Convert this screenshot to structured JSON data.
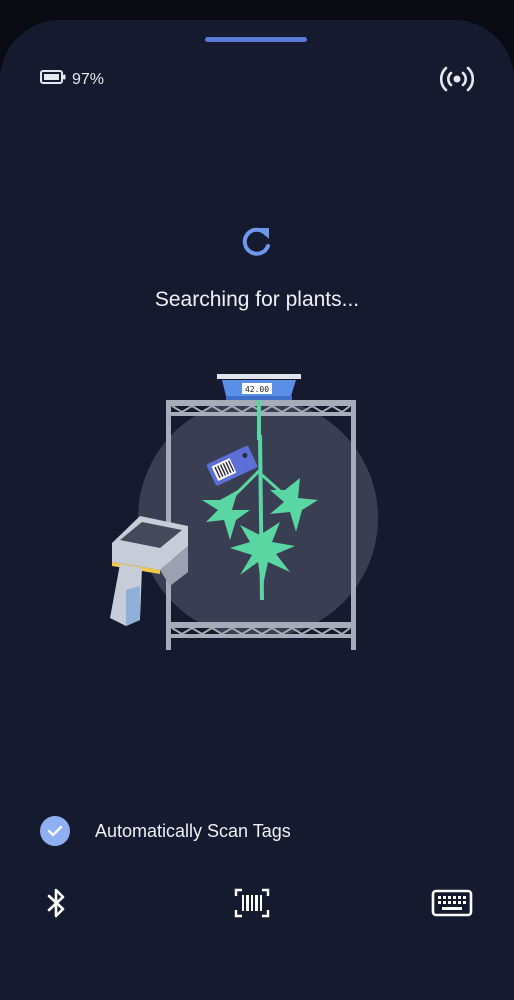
{
  "status": {
    "battery_percent": "97%",
    "battery_icon": "battery-icon",
    "broadcast_icon": "broadcast-icon"
  },
  "main": {
    "refresh_icon": "refresh-icon",
    "searching_text": "Searching for plants...",
    "scale_display": "42.00"
  },
  "options": {
    "auto_scan_label": "Automatically Scan Tags",
    "auto_scan_checked": true
  },
  "toolbar": {
    "items": [
      {
        "icon": "bluetooth-icon"
      },
      {
        "icon": "barcode-icon"
      },
      {
        "icon": "keyboard-icon"
      }
    ]
  },
  "colors": {
    "background": "#161a2e",
    "accent": "#5b7bd8",
    "refresh": "#6f97ea",
    "plant": "#5ad6a3",
    "scale": "#5b8ee6",
    "check": "#8fb0f0"
  }
}
